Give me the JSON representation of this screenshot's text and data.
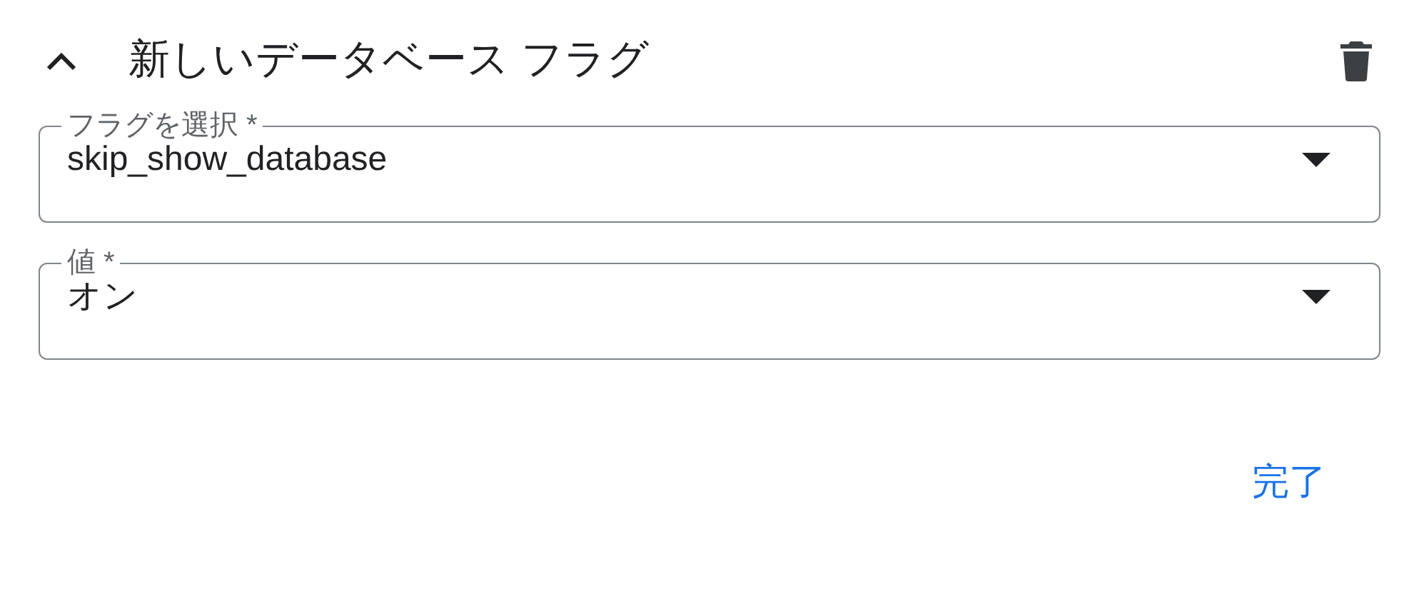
{
  "header": {
    "expanded": true,
    "title": "新しいデータベース フラグ"
  },
  "fields": [
    {
      "label": "フラグを選択 *",
      "value": "skip_show_database"
    },
    {
      "label": "値 *",
      "value": "オン"
    }
  ],
  "done_button": "完了"
}
